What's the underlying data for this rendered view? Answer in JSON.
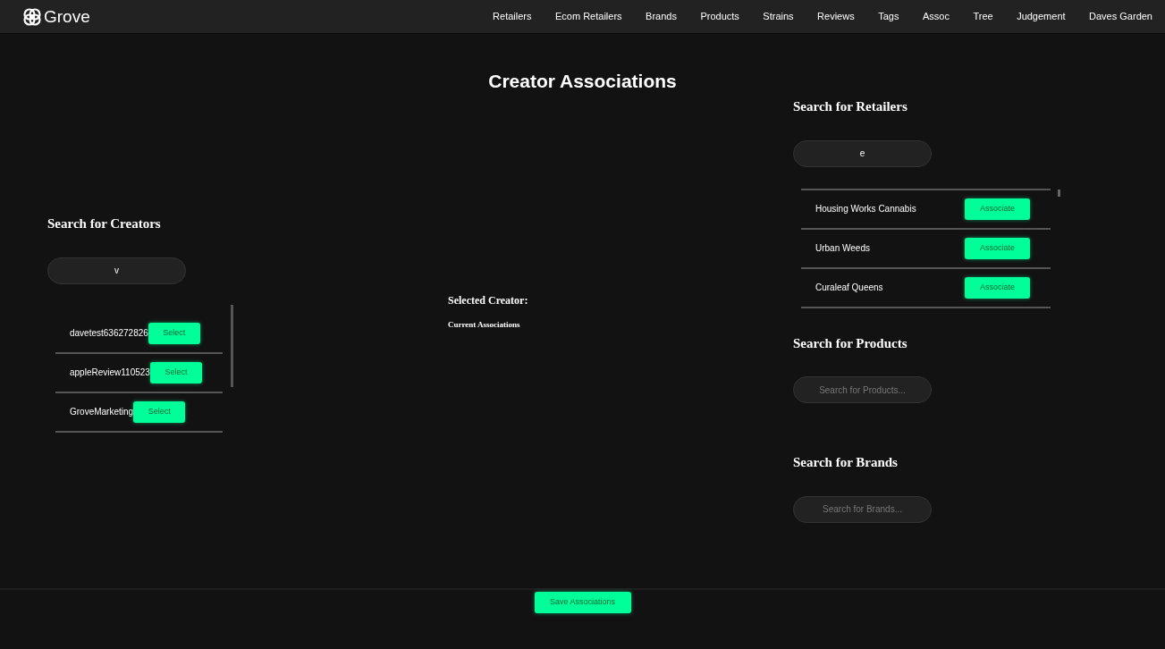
{
  "brand": "Grove",
  "nav": [
    "Retailers",
    "Ecom Retailers",
    "Brands",
    "Products",
    "Strains",
    "Reviews",
    "Tags",
    "Assoc",
    "Tree",
    "Judgement",
    "Daves Garden"
  ],
  "title": "Creator Associations",
  "creators": {
    "heading": "Search for Creators",
    "value": "v",
    "rows": [
      {
        "name": "davetest636272826",
        "button": "Select"
      },
      {
        "name": "appleReview110523",
        "button": "Select"
      },
      {
        "name": "GroveMarketing",
        "button": "Select"
      }
    ]
  },
  "selected": {
    "heading": "Selected Creator:",
    "subheading": "Current Associations"
  },
  "retailers": {
    "heading": "Search for Retailers",
    "value": "e",
    "rows": [
      {
        "name": "Housing Works Cannabis",
        "button": "Associate"
      },
      {
        "name": "Urban Weeds",
        "button": "Associate"
      },
      {
        "name": "Curaleaf Queens",
        "button": "Associate"
      }
    ]
  },
  "products": {
    "heading": "Search for Products",
    "placeholder": "Search for Products..."
  },
  "brands": {
    "heading": "Search for Brands",
    "placeholder": "Search for Brands..."
  },
  "save_button": "Save Associations"
}
